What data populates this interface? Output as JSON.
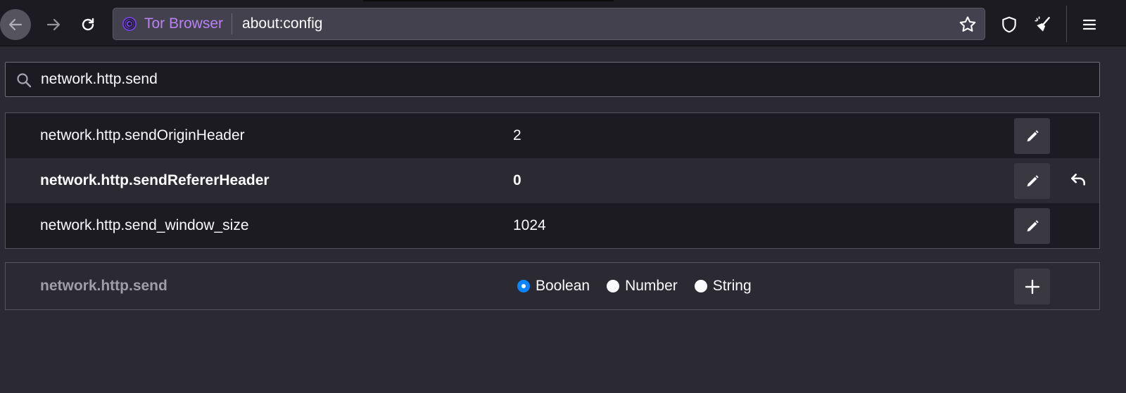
{
  "toolbar": {
    "identity_label": "Tor Browser",
    "url": "about:config"
  },
  "search": {
    "value": "network.http.send"
  },
  "prefs": [
    {
      "name": "network.http.sendOriginHeader",
      "value": "2",
      "modified": false
    },
    {
      "name": "network.http.sendRefererHeader",
      "value": "0",
      "modified": true
    },
    {
      "name": "network.http.send_window_size",
      "value": "1024",
      "modified": false
    }
  ],
  "add_pref": {
    "name": "network.http.send",
    "types": [
      "Boolean",
      "Number",
      "String"
    ],
    "selected_type": "Boolean"
  },
  "colors": {
    "background": "#2b2a33",
    "toolbar": "#1c1b22",
    "accent": "#0a84ff",
    "tor_purple": "#b982f3"
  },
  "icons": [
    "back-arrow-icon",
    "forward-arrow-icon",
    "reload-icon",
    "tor-onion-icon",
    "star-icon",
    "shield-icon",
    "new-identity-broom-icon",
    "hamburger-menu-icon",
    "search-icon",
    "pencil-icon",
    "undo-icon",
    "plus-icon"
  ]
}
